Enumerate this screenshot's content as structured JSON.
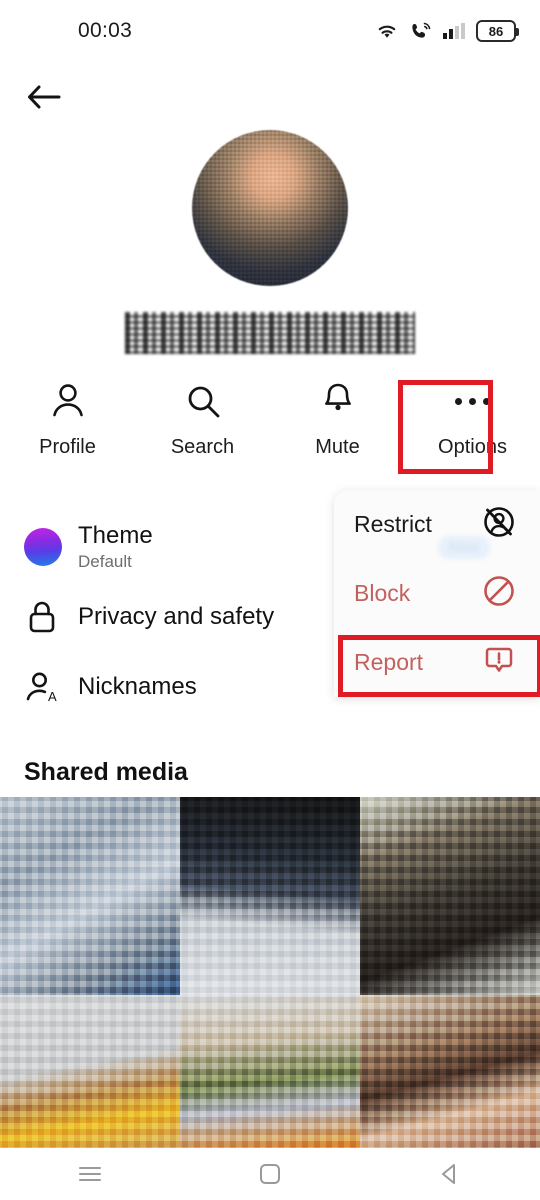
{
  "status_bar": {
    "time": "00:03",
    "battery_level": "86",
    "icons": [
      "wifi-icon",
      "call-icon",
      "signal-icon",
      "battery-icon"
    ]
  },
  "header": {
    "back_icon": "back-arrow-icon",
    "avatar": "profile-photo-blurred",
    "contact_name": "(blurred contact name)"
  },
  "actions": [
    {
      "label": "Profile",
      "icon": "person-icon",
      "highlighted": false
    },
    {
      "label": "Search",
      "icon": "search-icon",
      "highlighted": false
    },
    {
      "label": "Mute",
      "icon": "bell-icon",
      "highlighted": false
    },
    {
      "label": "Options",
      "icon": "three-dots-icon",
      "highlighted": true
    }
  ],
  "settings": [
    {
      "title": "Theme",
      "subtitle": "Default",
      "icon": "theme-color-circle"
    },
    {
      "title": "Privacy and safety",
      "subtitle": "",
      "icon": "lock-icon"
    },
    {
      "title": "Nicknames",
      "subtitle": "",
      "icon": "person-a-icon"
    }
  ],
  "options_menu": {
    "items": [
      {
        "label": "Restrict",
        "icon": "restrict-icon",
        "badge": "New",
        "highlighted": false
      },
      {
        "label": "Block",
        "icon": "block-icon",
        "badge": "",
        "highlighted": false
      },
      {
        "label": "Report",
        "icon": "report-icon",
        "badge": "",
        "highlighted": true
      }
    ]
  },
  "shared_media": {
    "heading": "Shared media",
    "thumbnails": [
      "shared-media-thumb-1",
      "shared-media-thumb-2",
      "shared-media-thumb-3",
      "shared-media-thumb-4",
      "shared-media-thumb-5",
      "shared-media-thumb-6"
    ]
  },
  "nav_bar": {
    "recents": "recents-icon",
    "home": "home-icon",
    "back": "back-triangle-icon"
  },
  "colors": {
    "highlight_red": "#e01b24",
    "danger_text": "#c4615f",
    "text_primary": "#121212",
    "text_secondary": "#6e6e6e",
    "badge_blue": "#e7f0fb"
  }
}
